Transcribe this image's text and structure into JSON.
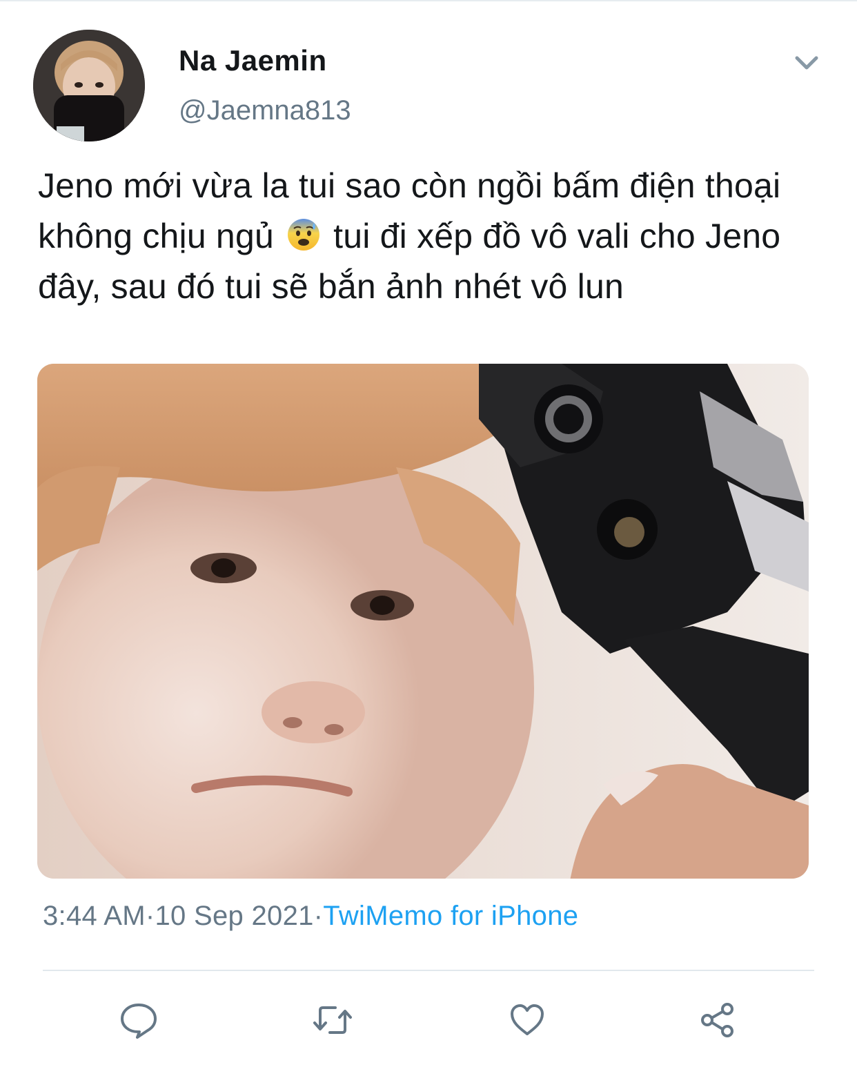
{
  "tweet": {
    "display_name": "Na Jaemin",
    "handle": "@Jaemna813",
    "text_before_emoji": "Jeno mới vừa la tui sao còn ngồi bấm điện thoại không chịu ngủ",
    "emoji": "😰",
    "text_after_emoji": "tui đi xếp đồ vô vali cho Jeno đây, sau đó tui sẽ bắn ảnh nhét vô lun",
    "time": "3:44 AM",
    "separator": "·",
    "date": "10 Sep 2021",
    "source": "TwiMemo for iPhone"
  },
  "icons": {
    "menu": "chevron-down-icon",
    "reply": "reply-icon",
    "retweet": "retweet-icon",
    "like": "heart-icon",
    "share": "share-icon"
  },
  "colors": {
    "text": "#14171a",
    "secondary": "#657786",
    "link": "#1da1f2",
    "divider": "#e1e8ed"
  }
}
